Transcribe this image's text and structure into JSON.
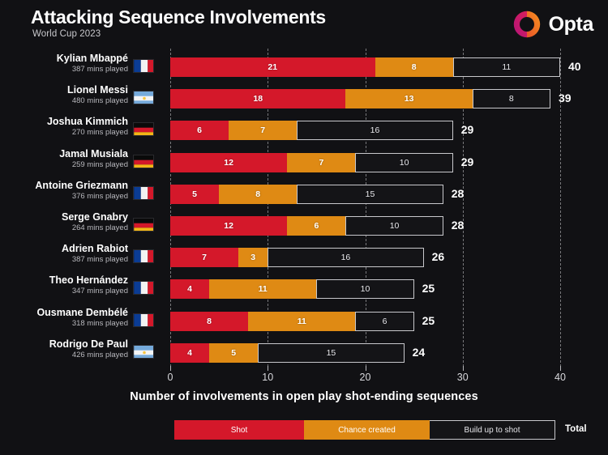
{
  "header": {
    "title": "Attacking Sequence Involvements",
    "subtitle": "World Cup 2023",
    "brand": "Opta",
    "logo_icon": "opta-circle-icon",
    "brand_colors": {
      "magenta": "#C2185B",
      "orange": "#F07B1E"
    }
  },
  "chart_data": {
    "type": "bar",
    "orientation": "horizontal",
    "stacked": true,
    "title": "Attacking Sequence Involvements",
    "subtitle": "World Cup 2023",
    "xlabel": "Number of involvements in open play shot-ending sequences",
    "ylabel": "",
    "xlim": [
      0,
      40
    ],
    "xticks": [
      0,
      10,
      20,
      30,
      40
    ],
    "xticklabels": [
      "0",
      "10",
      "20",
      "30",
      "40"
    ],
    "grid": "vertical-dashed",
    "legend_position": "bottom",
    "categories": [
      "Kylian Mbappé",
      "Lionel Messi",
      "Joshua Kimmich",
      "Jamal Musiala",
      "Antoine Griezmann",
      "Serge Gnabry",
      "Adrien Rabiot",
      "Theo Hernández",
      "Ousmane Dembélé",
      "Rodrigo De Paul"
    ],
    "series": [
      {
        "name": "Shot",
        "color": "#D4182A",
        "values": [
          21,
          18,
          6,
          12,
          5,
          12,
          7,
          4,
          8,
          4
        ]
      },
      {
        "name": "Chance created",
        "color": "#DF8A14",
        "values": [
          8,
          13,
          7,
          7,
          8,
          6,
          3,
          11,
          11,
          5
        ]
      },
      {
        "name": "Build up to shot",
        "color": "#141417",
        "values": [
          11,
          8,
          16,
          10,
          15,
          10,
          16,
          10,
          6,
          15
        ]
      }
    ],
    "totals": [
      40,
      39,
      29,
      29,
      28,
      28,
      26,
      25,
      25,
      24
    ],
    "total_label": "Total"
  },
  "rows": [
    {
      "name": "Kylian Mbappé",
      "mins": "387 mins played",
      "flag": "france-flag-icon",
      "shot": 21,
      "chance": 8,
      "build": 11,
      "total": 40
    },
    {
      "name": "Lionel Messi",
      "mins": "480 mins played",
      "flag": "argentina-flag-icon",
      "shot": 18,
      "chance": 13,
      "build": 8,
      "total": 39
    },
    {
      "name": "Joshua Kimmich",
      "mins": "270 mins played",
      "flag": "germany-flag-icon",
      "shot": 6,
      "chance": 7,
      "build": 16,
      "total": 29
    },
    {
      "name": "Jamal Musiala",
      "mins": "259 mins played",
      "flag": "germany-flag-icon",
      "shot": 12,
      "chance": 7,
      "build": 10,
      "total": 29
    },
    {
      "name": "Antoine Griezmann",
      "mins": "376 mins played",
      "flag": "france-flag-icon",
      "shot": 5,
      "chance": 8,
      "build": 15,
      "total": 28
    },
    {
      "name": "Serge Gnabry",
      "mins": "264 mins played",
      "flag": "germany-flag-icon",
      "shot": 12,
      "chance": 6,
      "build": 10,
      "total": 28
    },
    {
      "name": "Adrien Rabiot",
      "mins": "387 mins played",
      "flag": "france-flag-icon",
      "shot": 7,
      "chance": 3,
      "build": 16,
      "total": 26
    },
    {
      "name": "Theo Hernández",
      "mins": "347 mins played",
      "flag": "france-flag-icon",
      "shot": 4,
      "chance": 11,
      "build": 10,
      "total": 25
    },
    {
      "name": "Ousmane Dembélé",
      "mins": "318 mins played",
      "flag": "france-flag-icon",
      "shot": 8,
      "chance": 11,
      "build": 6,
      "total": 25
    },
    {
      "name": "Rodrigo De Paul",
      "mins": "426 mins played",
      "flag": "argentina-flag-icon",
      "shot": 4,
      "chance": 5,
      "build": 15,
      "total": 24
    }
  ],
  "axis": {
    "ticks": [
      "0",
      "10",
      "20",
      "30",
      "40"
    ],
    "label": "Number of involvements in open play shot-ending sequences"
  },
  "legend": {
    "items": [
      {
        "label": "Shot",
        "color": "#D4182A"
      },
      {
        "label": "Chance created",
        "color": "#DF8A14"
      },
      {
        "label": "Build up to shot",
        "color": "#141417"
      }
    ],
    "total_label": "Total"
  }
}
